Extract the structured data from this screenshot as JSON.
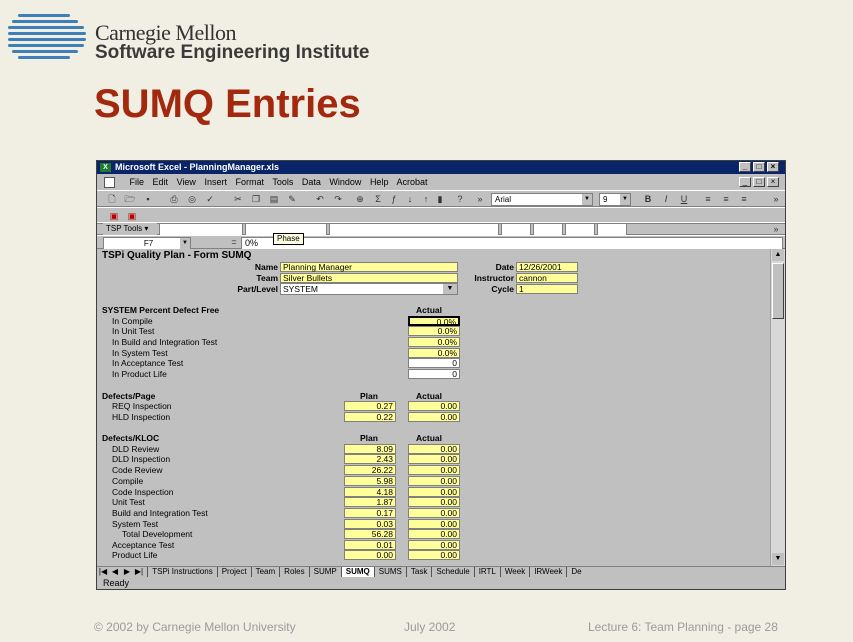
{
  "slide": {
    "brand_line1": "Carnegie Mellon",
    "brand_line2": "Software Engineering Institute",
    "title": "SUMQ Entries",
    "footer_left": "© 2002 by Carnegie Mellon University",
    "footer_center": "July 2002",
    "footer_right": "Lecture 6: Team Planning  - page 28"
  },
  "window": {
    "title": "Microsoft Excel - PlanningManager.xls",
    "menu": [
      "File",
      "Edit",
      "View",
      "Insert",
      "Format",
      "Tools",
      "Data",
      "Window",
      "Help",
      "Acrobat"
    ],
    "font_name": "Arial",
    "font_size": "9",
    "tsp_tools_label": "TSP Tools ▾",
    "name_box": "F7",
    "formula_value": "0%",
    "tooltip": "Phase",
    "status": "Ready"
  },
  "form": {
    "heading": "TSPi Quality Plan - Form SUMQ",
    "name_label": "Name",
    "name_value": "Planning Manager",
    "team_label": "Team",
    "team_value": "Silver Bullets",
    "part_label": "Part/Level",
    "part_value": "SYSTEM",
    "date_label": "Date",
    "date_value": "12/26/2001",
    "instructor_label": "Instructor",
    "instructor_value": "cannon",
    "cycle_label": "Cycle",
    "cycle_value": "1"
  },
  "defect_free": {
    "heading": "SYSTEM Percent Defect Free",
    "actual_header": "Actual",
    "rows": [
      {
        "label": "In Compile",
        "actual": "0.0%"
      },
      {
        "label": "In Unit Test",
        "actual": "0.0%"
      },
      {
        "label": "In Build and Integration Test",
        "actual": "0.0%"
      },
      {
        "label": "In System Test",
        "actual": "0.0%"
      },
      {
        "label": "In Acceptance Test",
        "actual": "0"
      },
      {
        "label": "In Product Life",
        "actual": "0"
      }
    ]
  },
  "defects_page": {
    "heading": "Defects/Page",
    "plan_header": "Plan",
    "actual_header": "Actual",
    "rows": [
      {
        "label": "REQ Inspection",
        "plan": "0.27",
        "actual": "0.00"
      },
      {
        "label": "HLD Inspection",
        "plan": "0.22",
        "actual": "0.00"
      }
    ]
  },
  "defects_kloc": {
    "heading": "Defects/KLOC",
    "plan_header": "Plan",
    "actual_header": "Actual",
    "rows": [
      {
        "label": "DLD Review",
        "plan": "8.09",
        "actual": "0.00"
      },
      {
        "label": "DLD Inspection",
        "plan": "2.43",
        "actual": "0.00"
      },
      {
        "label": "Code Review",
        "plan": "26.22",
        "actual": "0.00"
      },
      {
        "label": "Compile",
        "plan": "5.98",
        "actual": "0.00"
      },
      {
        "label": "Code Inspection",
        "plan": "4.18",
        "actual": "0.00"
      },
      {
        "label": "Unit Test",
        "plan": "1.87",
        "actual": "0.00"
      },
      {
        "label": "Build and Integration Test",
        "plan": "0.17",
        "actual": "0.00"
      },
      {
        "label": "System Test",
        "plan": "0.03",
        "actual": "0.00"
      },
      {
        "label": "Total Development",
        "plan": "56.28",
        "actual": "0.00"
      },
      {
        "label": "Acceptance Test",
        "plan": "0.01",
        "actual": "0.00"
      },
      {
        "label": "Product Life",
        "plan": "0.00",
        "actual": "0.00"
      }
    ]
  },
  "tabs": [
    "TSPi Instructions",
    "Project",
    "Team",
    "Roles",
    "SUMP",
    "SUMQ",
    "SUMS",
    "Task",
    "Schedule",
    "IRTL",
    "Week",
    "IRWeek",
    "De"
  ],
  "active_tab": "SUMQ"
}
